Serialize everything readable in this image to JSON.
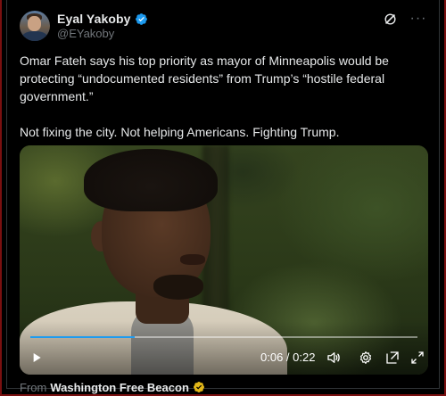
{
  "post": {
    "author": {
      "display_name": "Eyal Yakoby",
      "handle": "@EYakoby",
      "verified": true,
      "verified_color": "#1d9bf0"
    },
    "actions": {
      "grok_icon": "grok-icon",
      "more_label": "···"
    },
    "text": {
      "paragraph_1": "Omar Fateh says his top priority as mayor of Minneapolis would be protecting “undocumented residents” from Trump’s “hostile federal government.”",
      "paragraph_2": "Not fixing the city. Not helping Americans. Fighting Trump."
    },
    "video": {
      "time": "0:06 / 0:22",
      "progress_fraction": 0.27,
      "accent_color": "#1d9bf0",
      "controls": [
        "play-icon",
        "volume-icon",
        "settings-icon",
        "pop-out-icon",
        "fullscreen-icon"
      ]
    },
    "source": {
      "from_label": "From",
      "name": "Washington Free Beacon",
      "badge_color": "#e2b719"
    }
  },
  "colors": {
    "background": "#000000",
    "text_primary": "#e7e9ea",
    "text_secondary": "#71767b"
  }
}
